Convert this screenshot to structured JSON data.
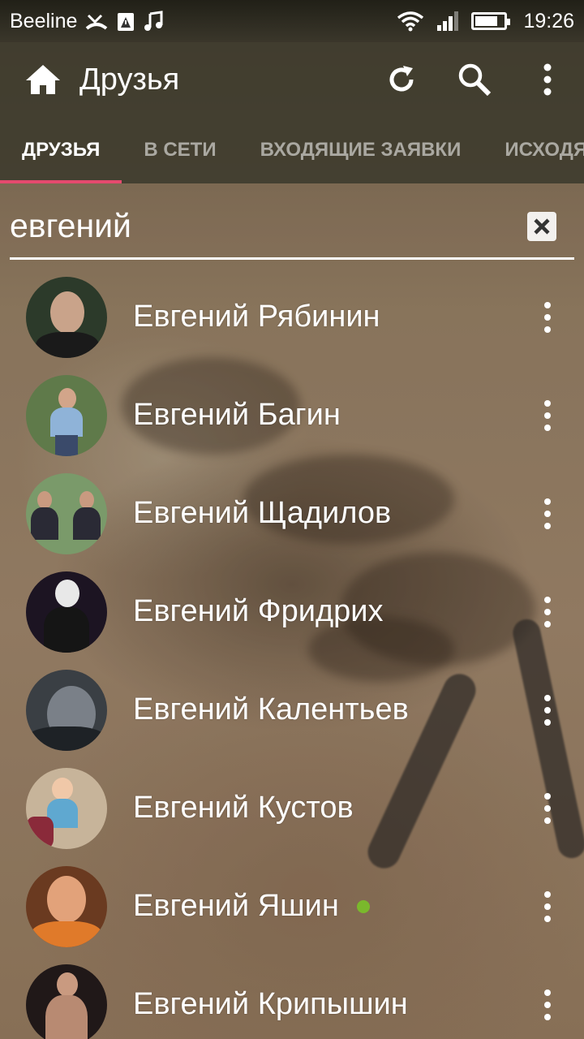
{
  "status_bar": {
    "carrier": "Beeline",
    "time": "19:26",
    "icons": [
      "missed-call-icon",
      "warning-icon",
      "music-icon",
      "wifi-icon",
      "signal-icon",
      "battery-icon"
    ],
    "battery_level": 0.7
  },
  "app_bar": {
    "title": "Друзья",
    "icons": [
      "home-icon",
      "refresh-icon",
      "search-icon",
      "more-vert-icon"
    ]
  },
  "tabs": [
    {
      "label": "ДРУЗЬЯ",
      "active": true
    },
    {
      "label": "В СЕТИ",
      "active": false
    },
    {
      "label": "ВХОДЯЩИЕ ЗАЯВКИ",
      "active": false
    },
    {
      "label": "ИСХОДЯ",
      "active": false
    }
  ],
  "search": {
    "value": "евгений",
    "clear_icon": "close-icon"
  },
  "friends": [
    {
      "name": "Евгений Рябинин",
      "online": false,
      "avatar_colors": [
        "#2c3a2a",
        "#c9a38a",
        "#1a1a1a"
      ]
    },
    {
      "name": "Евгений Багин",
      "online": false,
      "avatar_colors": [
        "#5f7a4a",
        "#d2a58a",
        "#8fb3d8"
      ]
    },
    {
      "name": "Евгений Щадилов",
      "online": false,
      "avatar_colors": [
        "#7a9a6a",
        "#c99a80",
        "#2a2a35"
      ]
    },
    {
      "name": "Евгений Фридрих",
      "online": false,
      "avatar_colors": [
        "#1c1422",
        "#e8e8e8",
        "#151515"
      ]
    },
    {
      "name": "Евгений Калентьев",
      "online": false,
      "avatar_colors": [
        "#3a3f44",
        "#7a8088",
        "#1e2226"
      ]
    },
    {
      "name": "Евгений Кустов",
      "online": false,
      "avatar_colors": [
        "#c7b49a",
        "#f0c8a8",
        "#5fa8d0"
      ]
    },
    {
      "name": "Евгений Яшин",
      "online": true,
      "avatar_colors": [
        "#6a3a20",
        "#e2a27a",
        "#e07a2a"
      ]
    },
    {
      "name": "Евгений Крипышин",
      "online": false,
      "avatar_colors": [
        "#201818",
        "#c99a80",
        "#3a2a2a"
      ]
    }
  ]
}
